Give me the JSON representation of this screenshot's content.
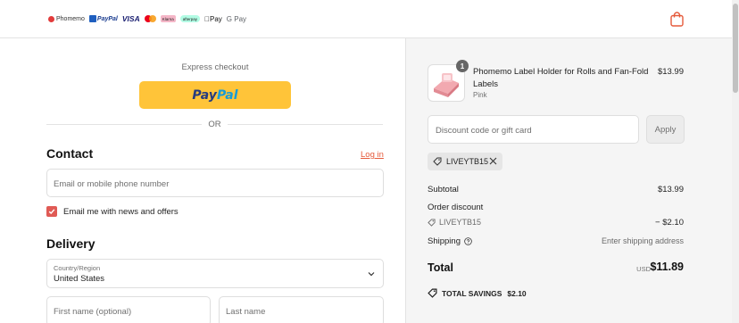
{
  "header": {
    "brands": [
      "Phomemo",
      "PayPal",
      "VISA",
      "Klarna",
      "afterpay",
      "Pay",
      "G Pay"
    ],
    "cart_icon": "shopping-bag-icon"
  },
  "express": {
    "label": "Express checkout",
    "paypal_pay": "Pay",
    "paypal_pal": "Pal",
    "or": "OR"
  },
  "contact": {
    "heading": "Contact",
    "login_label": "Log in",
    "email_placeholder": "Email or mobile phone number",
    "newsletter_label": "Email me with news and offers",
    "newsletter_checked": true
  },
  "delivery": {
    "heading": "Delivery",
    "country_label": "Country/Region",
    "country_value": "United States",
    "first_name_placeholder": "First name (optional)",
    "last_name_placeholder": "Last name"
  },
  "summary": {
    "product": {
      "title": "Phomemo Label Holder for Rolls and Fan-Fold Labels",
      "variant": "Pink",
      "price": "$13.99",
      "quantity": "1"
    },
    "discount_placeholder": "Discount code or gift card",
    "apply_label": "Apply",
    "applied_code": "LIVEYTB15",
    "subtotal_label": "Subtotal",
    "subtotal_value": "$13.99",
    "order_discount_label": "Order discount",
    "discount_code": "LIVEYTB15",
    "discount_value": "− $2.10",
    "shipping_label": "Shipping",
    "shipping_value": "Enter shipping address",
    "total_label": "Total",
    "currency": "USD",
    "total_value": "$11.89",
    "savings_label": "TOTAL SAVINGS",
    "savings_value": "$2.10"
  },
  "colors": {
    "accent": "#e55a3b",
    "paypal_yellow": "#ffc439",
    "checkbox": "#e05a55",
    "summary_bg": "#f5f5f5"
  }
}
